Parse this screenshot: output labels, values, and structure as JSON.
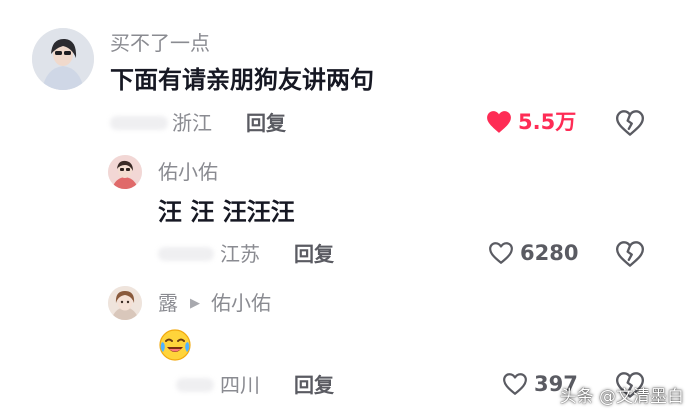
{
  "colors": {
    "like_active": "#fe2c55",
    "text_primary": "#161823",
    "text_secondary": "#8a8b91"
  },
  "comments": [
    {
      "username": "买不了一点",
      "content": "下面有请亲朋狗友讲两句",
      "location": "浙江",
      "reply_label": "回复",
      "likes": "5.5万",
      "liked": true,
      "avatar_icon": "user-avatar-icon"
    },
    {
      "username": "佑小佑",
      "content": "汪 汪 汪汪汪",
      "location": "江苏",
      "reply_label": "回复",
      "likes": "6280",
      "liked": false,
      "avatar_icon": "user-avatar-icon"
    },
    {
      "username": "露",
      "reply_to": "佑小佑",
      "emoji": "laughing-crying-face-emoji",
      "location": "四川",
      "reply_label": "回复",
      "likes": "397",
      "liked": false,
      "avatar_icon": "user-avatar-icon"
    }
  ],
  "icons": {
    "heart_filled": "heart-filled-icon",
    "heart_outline": "heart-outline-icon",
    "dislike": "broken-heart-icon",
    "reply_arrow": "triangle-right-icon"
  },
  "watermark": "头条 @文清墨白"
}
